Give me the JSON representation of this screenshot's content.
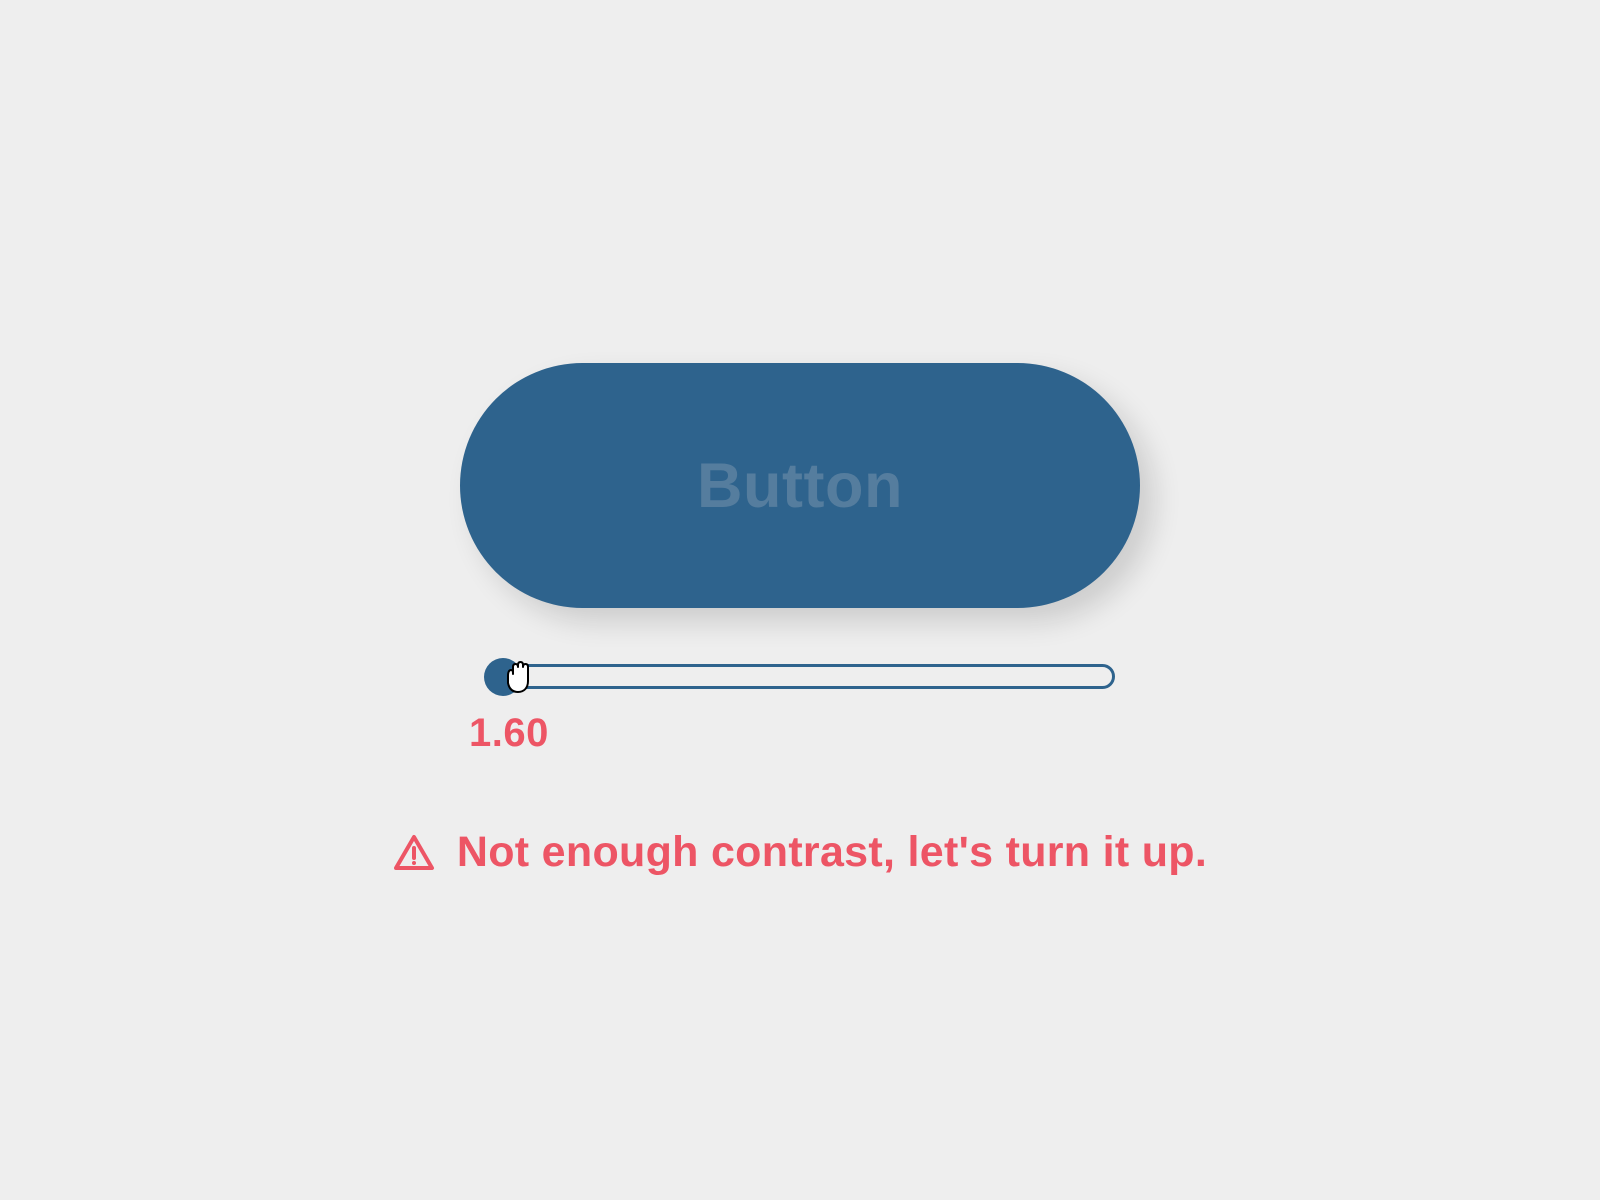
{
  "button": {
    "label": "Button",
    "background": "#2e638d",
    "text_color": "#557d9e"
  },
  "slider": {
    "value_label": "1.60",
    "value": 1.6,
    "position_percent": 0,
    "track_color": "#2e638d"
  },
  "warning": {
    "message": "Not enough contrast, let's turn it up.",
    "icon": "warning-triangle-icon",
    "color": "#ed5565"
  }
}
